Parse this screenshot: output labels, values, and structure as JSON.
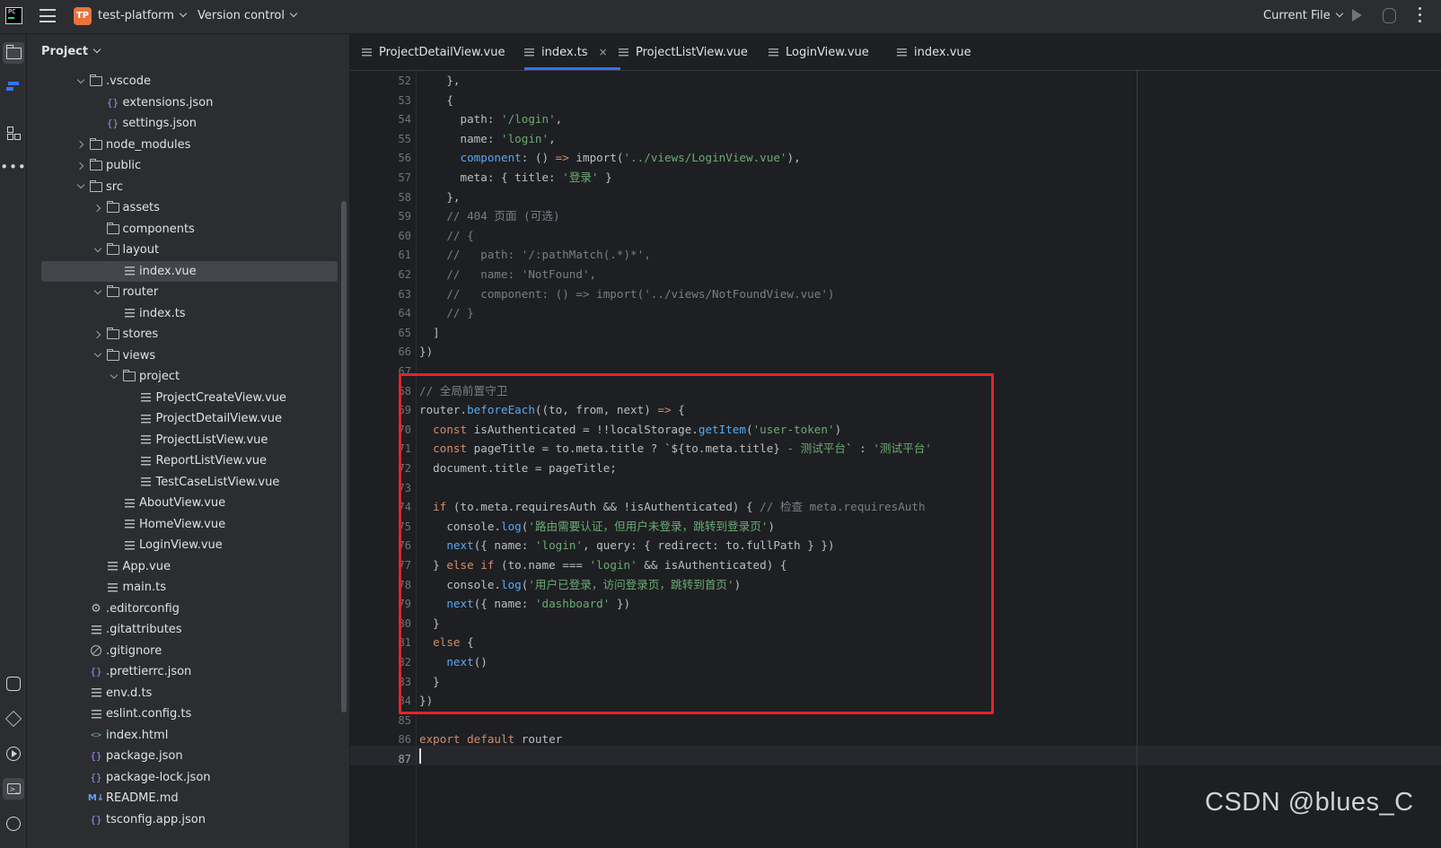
{
  "titlebar": {
    "logo_text": "PC",
    "project_badge": "TP",
    "project_name": "test-platform",
    "vcs_label": "Version control",
    "run_config": "Current File"
  },
  "toolstrip": {
    "top": [
      "folder-icon",
      "vcs-icon",
      "structure-icon",
      "more-icon"
    ],
    "bottom": [
      "python-console-icon",
      "layers-icon",
      "run-icon",
      "terminal-icon",
      "problems-icon"
    ]
  },
  "project_panel": {
    "title": "Project",
    "tree": [
      {
        "label": ".vscode",
        "depth": 0,
        "arrow": "down",
        "icon": "folder"
      },
      {
        "label": "extensions.json",
        "depth": 1,
        "arrow": "",
        "icon": "json"
      },
      {
        "label": "settings.json",
        "depth": 1,
        "arrow": "",
        "icon": "json"
      },
      {
        "label": "node_modules",
        "depth": 0,
        "arrow": "right",
        "icon": "folder"
      },
      {
        "label": "public",
        "depth": 0,
        "arrow": "right",
        "icon": "folder"
      },
      {
        "label": "src",
        "depth": 0,
        "arrow": "down",
        "icon": "folder"
      },
      {
        "label": "assets",
        "depth": 1,
        "arrow": "right",
        "icon": "folder"
      },
      {
        "label": "components",
        "depth": 1,
        "arrow": "",
        "icon": "folder"
      },
      {
        "label": "layout",
        "depth": 1,
        "arrow": "down",
        "icon": "folder"
      },
      {
        "label": "index.vue",
        "depth": 2,
        "arrow": "",
        "icon": "lines",
        "selected": true
      },
      {
        "label": "router",
        "depth": 1,
        "arrow": "down",
        "icon": "folder"
      },
      {
        "label": "index.ts",
        "depth": 2,
        "arrow": "",
        "icon": "lines"
      },
      {
        "label": "stores",
        "depth": 1,
        "arrow": "right",
        "icon": "folder"
      },
      {
        "label": "views",
        "depth": 1,
        "arrow": "down",
        "icon": "folder"
      },
      {
        "label": "project",
        "depth": 2,
        "arrow": "down",
        "icon": "folder"
      },
      {
        "label": "ProjectCreateView.vue",
        "depth": 3,
        "arrow": "",
        "icon": "lines"
      },
      {
        "label": "ProjectDetailView.vue",
        "depth": 3,
        "arrow": "",
        "icon": "lines"
      },
      {
        "label": "ProjectListView.vue",
        "depth": 3,
        "arrow": "",
        "icon": "lines"
      },
      {
        "label": "ReportListView.vue",
        "depth": 3,
        "arrow": "",
        "icon": "lines"
      },
      {
        "label": "TestCaseListView.vue",
        "depth": 3,
        "arrow": "",
        "icon": "lines"
      },
      {
        "label": "AboutView.vue",
        "depth": 2,
        "arrow": "",
        "icon": "lines"
      },
      {
        "label": "HomeView.vue",
        "depth": 2,
        "arrow": "",
        "icon": "lines"
      },
      {
        "label": "LoginView.vue",
        "depth": 2,
        "arrow": "",
        "icon": "lines"
      },
      {
        "label": "App.vue",
        "depth": 1,
        "arrow": "",
        "icon": "lines"
      },
      {
        "label": "main.ts",
        "depth": 1,
        "arrow": "",
        "icon": "lines"
      },
      {
        "label": ".editorconfig",
        "depth": 0,
        "arrow": "",
        "icon": "gear"
      },
      {
        "label": ".gitattributes",
        "depth": 0,
        "arrow": "",
        "icon": "lines"
      },
      {
        "label": ".gitignore",
        "depth": 0,
        "arrow": "",
        "icon": "ban"
      },
      {
        "label": ".prettierrc.json",
        "depth": 0,
        "arrow": "",
        "icon": "json"
      },
      {
        "label": "env.d.ts",
        "depth": 0,
        "arrow": "",
        "icon": "lines"
      },
      {
        "label": "eslint.config.ts",
        "depth": 0,
        "arrow": "",
        "icon": "lines"
      },
      {
        "label": "index.html",
        "depth": 0,
        "arrow": "",
        "icon": "html"
      },
      {
        "label": "package.json",
        "depth": 0,
        "arrow": "",
        "icon": "json"
      },
      {
        "label": "package-lock.json",
        "depth": 0,
        "arrow": "",
        "icon": "json"
      },
      {
        "label": "README.md",
        "depth": 0,
        "arrow": "",
        "icon": "md"
      },
      {
        "label": "tsconfig.app.json",
        "depth": 0,
        "arrow": "",
        "icon": "json"
      }
    ]
  },
  "tabs": [
    {
      "label": "ProjectDetailView.vue",
      "active": false
    },
    {
      "label": "index.ts",
      "active": true,
      "close": "×"
    },
    {
      "label": "ProjectListView.vue",
      "active": false
    },
    {
      "label": "LoginView.vue",
      "active": false
    },
    {
      "label": "index.vue",
      "active": false
    }
  ],
  "editor": {
    "current_line": 87,
    "lines": [
      {
        "n": "52",
        "seg": [
          [
            "",
            "    },"
          ]
        ]
      },
      {
        "n": "53",
        "seg": [
          [
            "",
            "    {"
          ]
        ]
      },
      {
        "n": "54",
        "seg": [
          [
            "",
            "      path: "
          ],
          [
            "s",
            "'/login'"
          ],
          [
            "",
            ","
          ]
        ]
      },
      {
        "n": "55",
        "seg": [
          [
            "",
            "      name: "
          ],
          [
            "s",
            "'login'"
          ],
          [
            "",
            ","
          ]
        ]
      },
      {
        "n": "56",
        "seg": [
          [
            "",
            "      "
          ],
          [
            "f",
            "component"
          ],
          [
            "",
            ": () "
          ],
          [
            "k",
            "=>"
          ],
          [
            "",
            " import("
          ],
          [
            "s",
            "'../views/LoginView.vue'"
          ],
          [
            "",
            "),"
          ]
        ]
      },
      {
        "n": "57",
        "seg": [
          [
            "",
            "      meta: { title: "
          ],
          [
            "s",
            "'登录'"
          ],
          [
            "",
            " }"
          ]
        ]
      },
      {
        "n": "58",
        "seg": [
          [
            "",
            "    },"
          ]
        ]
      },
      {
        "n": "59",
        "seg": [
          [
            "c",
            "    // 404 页面 (可选)"
          ]
        ]
      },
      {
        "n": "60",
        "seg": [
          [
            "c",
            "    // {"
          ]
        ]
      },
      {
        "n": "61",
        "seg": [
          [
            "c",
            "    //   path: '/:pathMatch(.*)*',"
          ]
        ]
      },
      {
        "n": "62",
        "seg": [
          [
            "c",
            "    //   name: 'NotFound',"
          ]
        ]
      },
      {
        "n": "63",
        "seg": [
          [
            "c",
            "    //   component: () => import('../views/NotFoundView.vue')"
          ]
        ]
      },
      {
        "n": "64",
        "seg": [
          [
            "c",
            "    // }"
          ]
        ]
      },
      {
        "n": "65",
        "seg": [
          [
            "",
            "  ]"
          ]
        ]
      },
      {
        "n": "66",
        "seg": [
          [
            "",
            "})"
          ]
        ]
      },
      {
        "n": "67",
        "seg": [
          [
            "",
            ""
          ]
        ]
      },
      {
        "n": "68",
        "seg": [
          [
            "c",
            "// 全局前置守卫"
          ]
        ]
      },
      {
        "n": "69",
        "seg": [
          [
            "",
            "router."
          ],
          [
            "f",
            "beforeEach"
          ],
          [
            "",
            "((to, from, next) "
          ],
          [
            "k",
            "=>"
          ],
          [
            "",
            " {"
          ]
        ]
      },
      {
        "n": "70",
        "seg": [
          [
            "",
            "  "
          ],
          [
            "k",
            "const"
          ],
          [
            "",
            " isAuthenticated = !!localStorage."
          ],
          [
            "f",
            "getItem"
          ],
          [
            "",
            "("
          ],
          [
            "s",
            "'user-token'"
          ],
          [
            "",
            ")"
          ]
        ]
      },
      {
        "n": "71",
        "seg": [
          [
            "",
            "  "
          ],
          [
            "k",
            "const"
          ],
          [
            "",
            " pageTitle = to.meta.title ? `${to.meta.title}"
          ],
          [
            "s",
            " - 测试平台"
          ],
          [
            "",
            "` : "
          ],
          [
            "s",
            "'测试平台'"
          ]
        ]
      },
      {
        "n": "72",
        "seg": [
          [
            "",
            "  document.title = pageTitle;"
          ]
        ]
      },
      {
        "n": "73",
        "seg": [
          [
            "",
            ""
          ]
        ]
      },
      {
        "n": "74",
        "seg": [
          [
            "",
            "  "
          ],
          [
            "k",
            "if"
          ],
          [
            "",
            " (to.meta.requiresAuth && !isAuthenticated) { "
          ],
          [
            "c",
            "// 检查 meta.requiresAuth"
          ]
        ]
      },
      {
        "n": "75",
        "seg": [
          [
            "",
            "    console."
          ],
          [
            "f",
            "log"
          ],
          [
            "",
            "("
          ],
          [
            "s",
            "'路由需要认证，但用户未登录，跳转到登录页'"
          ],
          [
            "",
            ")"
          ]
        ]
      },
      {
        "n": "76",
        "seg": [
          [
            "",
            "    "
          ],
          [
            "f",
            "next"
          ],
          [
            "",
            "({ name: "
          ],
          [
            "s",
            "'login'"
          ],
          [
            "",
            ", query: { redirect: to.fullPath } })"
          ]
        ]
      },
      {
        "n": "77",
        "seg": [
          [
            "",
            "  } "
          ],
          [
            "k",
            "else if"
          ],
          [
            "",
            " (to.name === "
          ],
          [
            "s",
            "'login'"
          ],
          [
            "",
            " && isAuthenticated) {"
          ]
        ]
      },
      {
        "n": "78",
        "seg": [
          [
            "",
            "    console."
          ],
          [
            "f",
            "log"
          ],
          [
            "",
            "("
          ],
          [
            "s",
            "'用户已登录，访问登录页，跳转到首页'"
          ],
          [
            "",
            ")"
          ]
        ]
      },
      {
        "n": "79",
        "seg": [
          [
            "",
            "    "
          ],
          [
            "f",
            "next"
          ],
          [
            "",
            "({ name: "
          ],
          [
            "s",
            "'dashboard'"
          ],
          [
            "",
            " })"
          ]
        ]
      },
      {
        "n": "80",
        "seg": [
          [
            "",
            "  }"
          ]
        ]
      },
      {
        "n": "81",
        "seg": [
          [
            "",
            "  "
          ],
          [
            "k",
            "else"
          ],
          [
            "",
            " {"
          ]
        ]
      },
      {
        "n": "82",
        "seg": [
          [
            "",
            "    "
          ],
          [
            "f",
            "next"
          ],
          [
            "",
            "()"
          ]
        ]
      },
      {
        "n": "83",
        "seg": [
          [
            "",
            "  }"
          ]
        ]
      },
      {
        "n": "84",
        "seg": [
          [
            "",
            "})"
          ]
        ]
      },
      {
        "n": "85",
        "seg": [
          [
            "",
            ""
          ]
        ]
      },
      {
        "n": "86",
        "seg": [
          [
            "k",
            "export default"
          ],
          [
            "",
            " router"
          ]
        ]
      },
      {
        "n": "87",
        "seg": [
          [
            "",
            ""
          ]
        ]
      }
    ]
  },
  "watermark": "CSDN @blues_C",
  "colors": {
    "accent": "#3574f0",
    "highlight_box": "#e0252a"
  }
}
